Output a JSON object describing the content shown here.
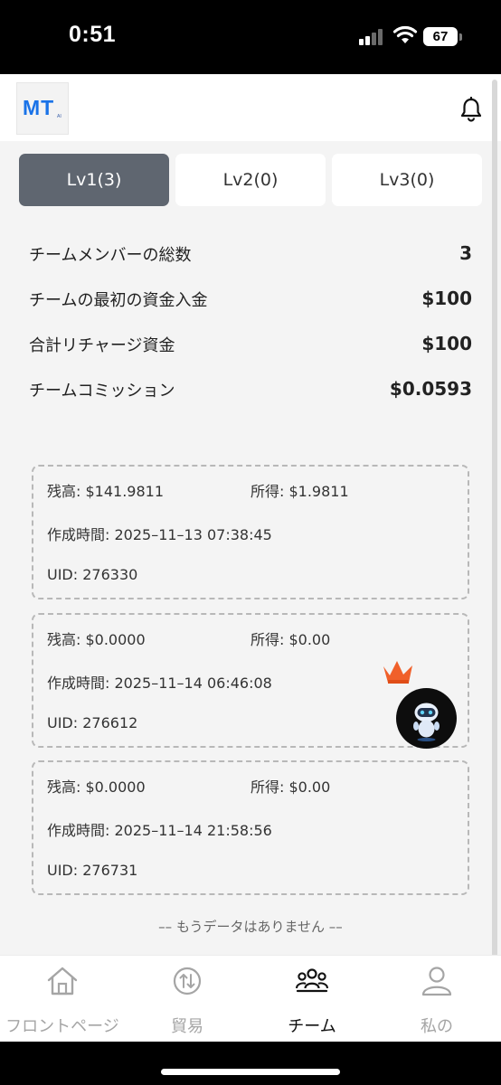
{
  "status_bar": {
    "time": "0:51",
    "battery": "67"
  },
  "header": {
    "logo_text": "MT",
    "logo_sub": "AI",
    "icons": [
      "bell-icon"
    ]
  },
  "tabs": [
    {
      "label": "Lv1(3)",
      "active": true
    },
    {
      "label": "Lv2(0)",
      "active": false
    },
    {
      "label": "Lv3(0)",
      "active": false
    }
  ],
  "summary": [
    {
      "label": "チームメンバーの総数",
      "value": "3"
    },
    {
      "label": "チームの最初の資金入金",
      "value": "$100"
    },
    {
      "label": "合計リチャージ資金",
      "value": "$100"
    },
    {
      "label": "チームコミッション",
      "value": "$0.0593"
    }
  ],
  "members": [
    {
      "balance": "残高: $141.9811",
      "income": "所得: $1.9811",
      "created": "作成時間: 2025–11–13 07:38:45",
      "uid": "UID: 276330"
    },
    {
      "balance": "残高: $0.0000",
      "income": "所得: $0.00",
      "created": "作成時間: 2025–11–14 06:46:08",
      "uid": "UID: 276612"
    },
    {
      "balance": "残高: $0.0000",
      "income": "所得: $0.00",
      "created": "作成時間: 2025–11–14 21:58:56",
      "uid": "UID: 276731"
    }
  ],
  "no_more": "–– もうデータはありません ––",
  "bottom_nav": [
    {
      "label": "フロントページ",
      "icon": "home-icon",
      "active": false
    },
    {
      "label": "貿易",
      "icon": "trade-icon",
      "active": false
    },
    {
      "label": "チーム",
      "icon": "team-icon",
      "active": true
    },
    {
      "label": "私の",
      "icon": "profile-icon",
      "active": false
    }
  ]
}
